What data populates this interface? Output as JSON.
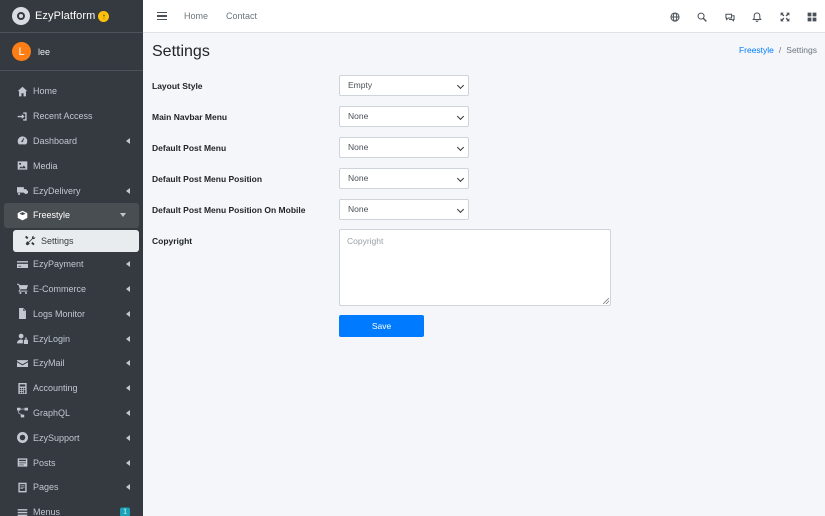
{
  "brand": {
    "name": "EzyPlatform",
    "upgrade_icon": "arrow-up-circle-icon"
  },
  "user": {
    "initial": "L",
    "name": "lee"
  },
  "sidebar": {
    "items": [
      {
        "label": "Home",
        "icon": "home-icon",
        "expandable": false
      },
      {
        "label": "Recent Access",
        "icon": "sign-in-icon",
        "expandable": false
      },
      {
        "label": "Dashboard",
        "icon": "dashboard-icon",
        "expandable": true
      },
      {
        "label": "Media",
        "icon": "image-icon",
        "expandable": false
      },
      {
        "label": "EzyDelivery",
        "icon": "truck-icon",
        "expandable": true
      },
      {
        "label": "Freestyle",
        "icon": "cube-icon",
        "expandable": true,
        "open": true
      },
      {
        "label": "Settings",
        "icon": "tools-icon",
        "active": true
      },
      {
        "label": "EzyPayment",
        "icon": "credit-card-icon",
        "expandable": true
      },
      {
        "label": "E-Commerce",
        "icon": "cart-icon",
        "expandable": true
      },
      {
        "label": "Logs Monitor",
        "icon": "file-icon",
        "expandable": true
      },
      {
        "label": "EzyLogin",
        "icon": "user-lock-icon",
        "expandable": true
      },
      {
        "label": "EzyMail",
        "icon": "envelope-icon",
        "expandable": true
      },
      {
        "label": "Accounting",
        "icon": "calculator-icon",
        "expandable": true
      },
      {
        "label": "GraphQL",
        "icon": "project-diagram-icon",
        "expandable": true
      },
      {
        "label": "EzySupport",
        "icon": "support-icon",
        "expandable": true
      },
      {
        "label": "Posts",
        "icon": "posts-icon",
        "expandable": true
      },
      {
        "label": "Pages",
        "icon": "pages-icon",
        "expandable": true
      },
      {
        "label": "Menus",
        "icon": "menu-icon",
        "badge": "1"
      }
    ]
  },
  "topbar": {
    "links": [
      "Home",
      "Contact"
    ],
    "icons": [
      "globe-icon",
      "search-icon",
      "comments-icon",
      "bell-icon",
      "expand-icon",
      "grid-icon"
    ]
  },
  "page": {
    "title": "Settings",
    "breadcrumb": {
      "parent": "Freestyle",
      "separator": "/",
      "current": "Settings"
    }
  },
  "form": {
    "fields": [
      {
        "label": "Layout Style",
        "value": "Empty"
      },
      {
        "label": "Main Navbar Menu",
        "value": "None"
      },
      {
        "label": "Default Post Menu",
        "value": "None"
      },
      {
        "label": "Default Post Menu Position",
        "value": "None"
      },
      {
        "label": "Default Post Menu Position On Mobile",
        "value": "None"
      }
    ],
    "copyright": {
      "label": "Copyright",
      "placeholder": "Copyright"
    },
    "save_label": "Save"
  },
  "colors": {
    "sidebar_bg": "#343a40",
    "accent": "#007bff",
    "avatar": "#fd7e14",
    "badge": "#17a2b8",
    "brand_up": "#ffc107"
  }
}
